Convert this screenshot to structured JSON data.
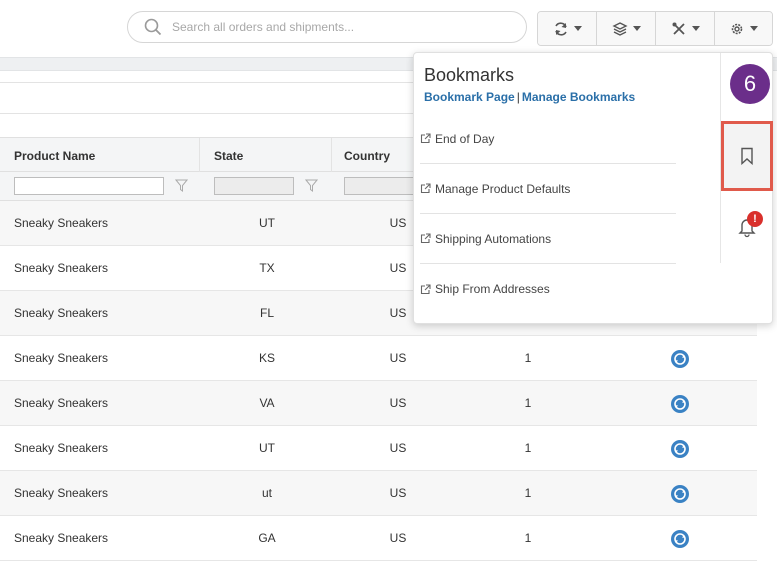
{
  "search": {
    "placeholder": "Search all orders and shipments..."
  },
  "toolbar": {
    "buttons": [
      "refresh-icon",
      "layers-icon",
      "tools-icon",
      "gear-icon"
    ]
  },
  "table": {
    "headers": {
      "product": "Product Name",
      "state": "State",
      "country": "Country"
    },
    "rows": [
      {
        "product": "Sneaky Sneakers",
        "state": "UT",
        "country": "US",
        "qty": ""
      },
      {
        "product": "Sneaky Sneakers",
        "state": "TX",
        "country": "US",
        "qty": ""
      },
      {
        "product": "Sneaky Sneakers",
        "state": "FL",
        "country": "US",
        "qty": ""
      },
      {
        "product": "Sneaky Sneakers",
        "state": "KS",
        "country": "US",
        "qty": "1"
      },
      {
        "product": "Sneaky Sneakers",
        "state": "VA",
        "country": "US",
        "qty": "1"
      },
      {
        "product": "Sneaky Sneakers",
        "state": "UT",
        "country": "US",
        "qty": "1"
      },
      {
        "product": "Sneaky Sneakers",
        "state": "ut",
        "country": "US",
        "qty": "1"
      },
      {
        "product": "Sneaky Sneakers",
        "state": "GA",
        "country": "US",
        "qty": "1"
      }
    ]
  },
  "bookmarks": {
    "title": "Bookmarks",
    "bookmark_page": "Bookmark Page",
    "separator": "|",
    "manage": "Manage Bookmarks",
    "items": [
      "End of Day",
      "Manage Product Defaults",
      "Shipping Automations",
      "Ship From Addresses"
    ]
  },
  "rail": {
    "badge_count": "6",
    "alert": "!"
  },
  "colors": {
    "accent": "#2a6fa8",
    "badge": "#6b2e8a",
    "highlight": "#e05a4b",
    "alert": "#d9302c"
  }
}
